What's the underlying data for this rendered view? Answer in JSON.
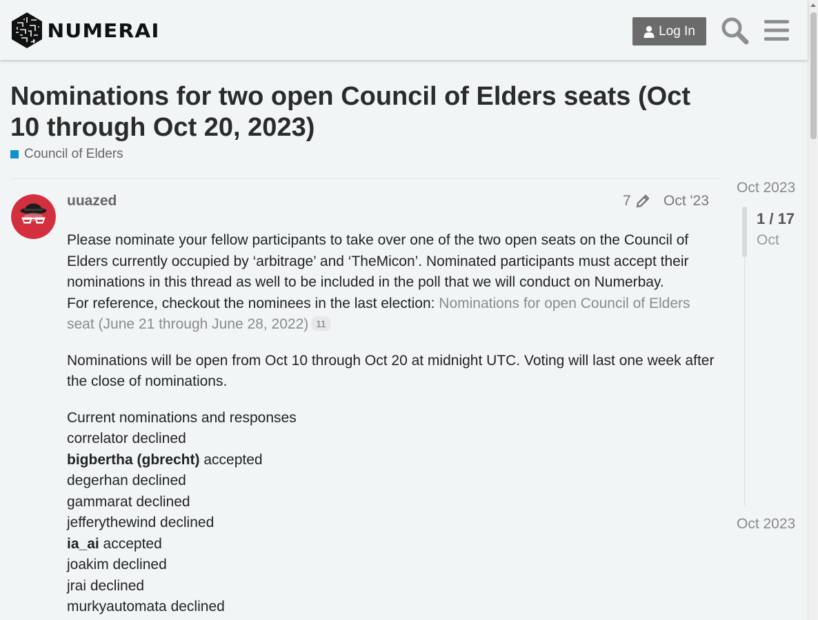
{
  "header": {
    "logo_text": "NUMERAI",
    "login_label": "Log In"
  },
  "topic": {
    "title": "Nominations for two open Council of Elders seats (Oct 10 through Oct 20, 2023)",
    "category": "Council of Elders",
    "category_color": "#0e8fce"
  },
  "post": {
    "username": "uuazed",
    "edit_count": "7",
    "date": "Oct '23",
    "intro": "Please nominate your fellow participants to take over one of the two open seats on the Council of Elders currently occupied by ‘arbitrage’ and ‘TheMicon’. Nominated participants must accept their nominations in this thread as well to be included in the poll that we will conduct on Numerbay.",
    "reference_prefix": "For reference, checkout the nominees in the last election: ",
    "reference_link": "Nominations for open Council of Elders seat (June 21 through June 28, 2022)",
    "reference_clicks": "11",
    "schedule": "Nominations will be open from Oct 10 through Oct 20 at midnight UTC. Voting will last one week after the close of nominations.",
    "nominations_heading": "Current nominations and responses",
    "nominations": [
      {
        "name": "correlator",
        "status": " declined"
      },
      {
        "name": "bigbertha (gbrecht)",
        "status": " accepted"
      },
      {
        "name": "degerhan",
        "status": " declined"
      },
      {
        "name": "gammarat",
        "status": " declined"
      },
      {
        "name": "jefferythewind",
        "status": " declined"
      },
      {
        "name": "ia_ai",
        "status": " accepted"
      },
      {
        "name": "joakim",
        "status": " declined"
      },
      {
        "name": "jrai",
        "status": " declined"
      },
      {
        "name": "murkyautomata",
        "status": " declined"
      }
    ]
  },
  "timeline": {
    "start": "Oct 2023",
    "position": "1 / 17",
    "position_date": "Oct",
    "end": "Oct 2023"
  }
}
